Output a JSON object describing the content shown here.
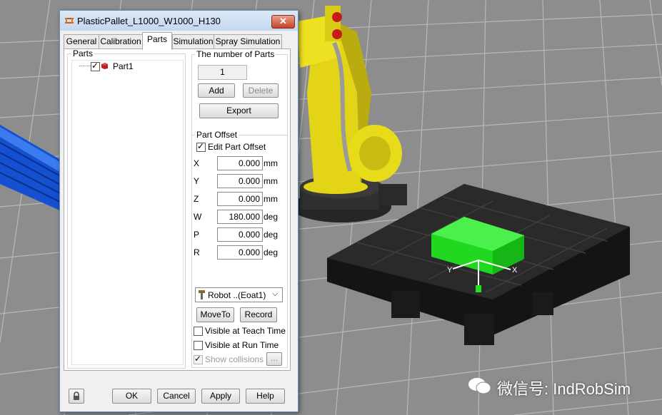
{
  "dialog": {
    "title": "PlasticPallet_L1000_W1000_H130",
    "close_glyph": "✕",
    "tabs": [
      {
        "label": "General"
      },
      {
        "label": "Calibration"
      },
      {
        "label": "Parts"
      },
      {
        "label": "Simulation"
      },
      {
        "label": "Spray Simulation"
      }
    ],
    "active_tab": "Parts",
    "parts_group": {
      "label": "Parts",
      "tree": [
        {
          "label": "Part1",
          "checked": true
        }
      ]
    },
    "count_group": {
      "label": "The number of Parts",
      "count": "1",
      "add_label": "Add",
      "delete_label": "Delete",
      "export_label": "Export"
    },
    "offset_group": {
      "label": "Part Offset",
      "edit_label": "Edit Part Offset",
      "edit_checked": true,
      "rows": [
        {
          "axis": "X",
          "value": "0.000",
          "unit": "mm"
        },
        {
          "axis": "Y",
          "value": "0.000",
          "unit": "mm"
        },
        {
          "axis": "Z",
          "value": "0.000",
          "unit": "mm"
        },
        {
          "axis": "W",
          "value": "180.000",
          "unit": "deg"
        },
        {
          "axis": "P",
          "value": "0.000",
          "unit": "deg"
        },
        {
          "axis": "R",
          "value": "0.000",
          "unit": "deg"
        }
      ],
      "tool_select": "Robot ..(Eoat1)",
      "moveto_label": "MoveTo",
      "record_label": "Record",
      "visible_teach_label": "Visible at Teach Time",
      "visible_run_label": "Visible at Run Time",
      "show_collisions_label": "Show collisions",
      "more_label": "..."
    },
    "footer": {
      "ok_label": "OK",
      "cancel_label": "Cancel",
      "apply_label": "Apply",
      "help_label": "Help"
    }
  },
  "viewport": {
    "axis_x_label": "X",
    "axis_y_label": "Y",
    "watermark": "微信号: IndRobSim"
  },
  "colors": {
    "background_grid": "#8c8c8c",
    "robot": "#e8dc1a",
    "pallet": "#1c1c1c",
    "part": "#22e022",
    "conveyor": "#1a5fe0"
  }
}
